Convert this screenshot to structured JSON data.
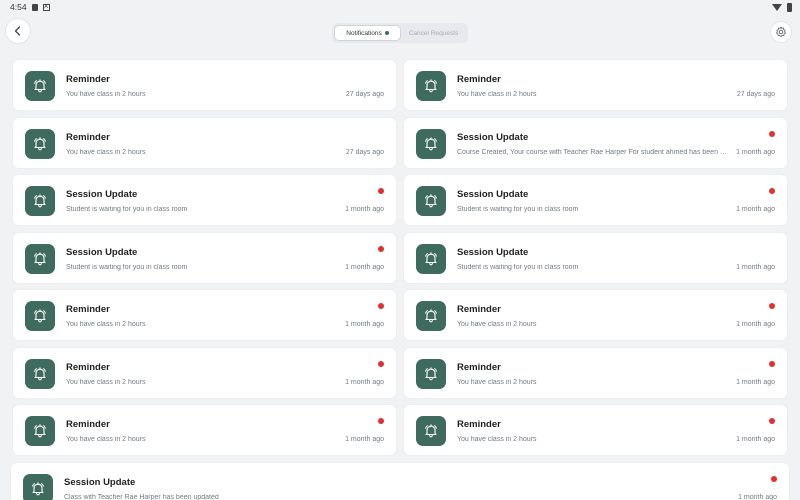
{
  "status_bar": {
    "time": "4:54"
  },
  "tabs": [
    {
      "label": "Notifications",
      "active": true
    },
    {
      "label": "Cancel Requests",
      "active": false
    }
  ],
  "colors": {
    "accent": "#3f6b5e",
    "unread": "#e0302f",
    "background": "#f1f2f4"
  },
  "icons": {
    "back": "chevron-left-icon",
    "settings": "gear-icon",
    "notification": "bell-icon"
  },
  "notifications": [
    {
      "title": "Reminder",
      "message": "You have class in 2 hours",
      "time": "27 days ago",
      "unread": false
    },
    {
      "title": "Reminder",
      "message": "You have class in 2 hours",
      "time": "27 days ago",
      "unread": false
    },
    {
      "title": "Reminder",
      "message": "You have class in 2 hours",
      "time": "27 days ago",
      "unread": false
    },
    {
      "title": "Session Update",
      "message": "Course Created, Your course with Teacher Rae Harper For student ahmed has been created",
      "time": "1 month ago",
      "unread": true
    },
    {
      "title": "Session Update",
      "message": "Student is waiting for you in class room",
      "time": "1 month ago",
      "unread": true
    },
    {
      "title": "Session Update",
      "message": "Student is waiting for you in class room",
      "time": "1 month ago",
      "unread": true
    },
    {
      "title": "Session Update",
      "message": "Student is waiting for you in class room",
      "time": "1 month ago",
      "unread": true
    },
    {
      "title": "Session Update",
      "message": "Student is waiting for you in class room",
      "time": "1 month ago",
      "unread": false
    },
    {
      "title": "Reminder",
      "message": "You have class in 2 hours",
      "time": "1 month ago",
      "unread": true
    },
    {
      "title": "Reminder",
      "message": "You have class in 2 hours",
      "time": "1 month ago",
      "unread": true
    },
    {
      "title": "Reminder",
      "message": "You have class in 2 hours",
      "time": "1 month ago",
      "unread": true
    },
    {
      "title": "Reminder",
      "message": "You have class in 2 hours",
      "time": "1 month ago",
      "unread": true
    },
    {
      "title": "Reminder",
      "message": "You have class in 2 hours",
      "time": "1 month ago",
      "unread": true
    },
    {
      "title": "Reminder",
      "message": "You have class in 2 hours",
      "time": "1 month ago",
      "unread": true
    },
    {
      "title": "Session Update",
      "message": "Class with Teacher Rae Harper has been updated",
      "time": "1 month ago",
      "unread": true
    }
  ]
}
